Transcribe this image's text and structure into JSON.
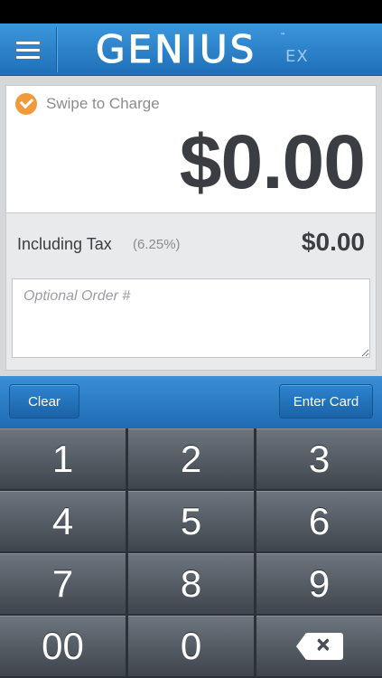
{
  "header": {
    "logo_main": "GENIUS",
    "logo_sub": "EX",
    "logo_tm": "™"
  },
  "charge": {
    "swipe_label": "Swipe to Charge",
    "amount": "$0.00",
    "tax_label": "Including Tax",
    "tax_rate": "(6.25%)",
    "tax_amount": "$0.00",
    "order_placeholder": "Optional Order #",
    "order_value": ""
  },
  "actions": {
    "clear_label": "Clear",
    "enter_card_label": "Enter Card"
  },
  "keypad": {
    "keys": [
      "1",
      "2",
      "3",
      "4",
      "5",
      "6",
      "7",
      "8",
      "9",
      "00",
      "0"
    ],
    "backspace_glyph": "✕"
  },
  "colors": {
    "header_blue": "#2a83cf",
    "check_orange": "#f19a3a",
    "key_gray": "#5a626b"
  }
}
